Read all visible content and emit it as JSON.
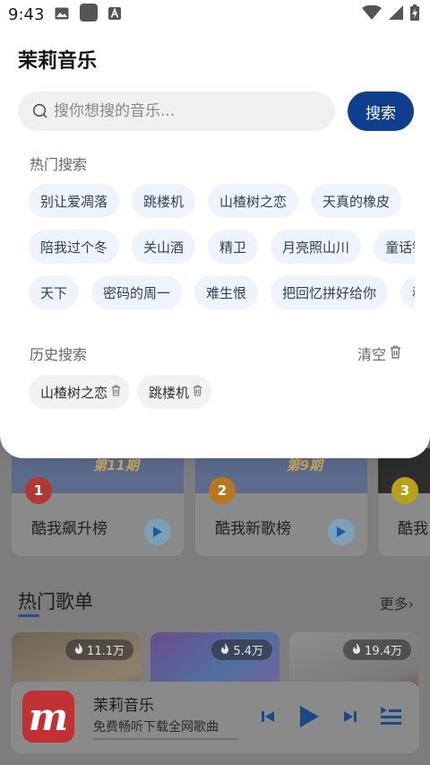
{
  "status_bar": {
    "time": "9:43"
  },
  "overlay": {
    "app_title": "茉莉音乐",
    "search": {
      "placeholder": "搜你想搜的音乐...",
      "button_label": "搜索"
    },
    "hot_search": {
      "label": "热门搜索",
      "rows": [
        [
          "别让爱凋落",
          "跳楼机",
          "山楂树之恋",
          "天真的橡皮"
        ],
        [
          "陪我过个冬",
          "关山酒",
          "精卫",
          "月亮照山川",
          "童话镇"
        ],
        [
          "天下",
          "密码的周一",
          "难生恨",
          "把回忆拼好给你",
          "稻香"
        ]
      ]
    },
    "history": {
      "label": "历史搜索",
      "clear_label": "清空",
      "items": [
        "山楂树之恋",
        "跳楼机"
      ]
    }
  },
  "background": {
    "rank_cards": [
      {
        "rank": "1",
        "name": "酷我飙升榜",
        "issue": "第11期",
        "badge_color": "#b03a33"
      },
      {
        "rank": "2",
        "name": "酷我新歌榜",
        "issue": "第9期",
        "badge_color": "#b8761e"
      },
      {
        "rank": "3",
        "name": "酷我",
        "issue": "",
        "badge_color": "#b8a01a"
      }
    ],
    "section": {
      "title": "热门歌单",
      "more_label": "更多›"
    },
    "playlists": [
      {
        "count": "11.1万"
      },
      {
        "count": "5.4万"
      },
      {
        "count": "19.4万"
      }
    ]
  },
  "player": {
    "logo_letter": "m",
    "title": "茉莉音乐",
    "subtitle": "免费畅听下载全网歌曲",
    "progress": 0
  },
  "colors": {
    "accent": "#0f3e8c",
    "tag_bg": "#eef3fc",
    "brand_red": "#c03034"
  }
}
